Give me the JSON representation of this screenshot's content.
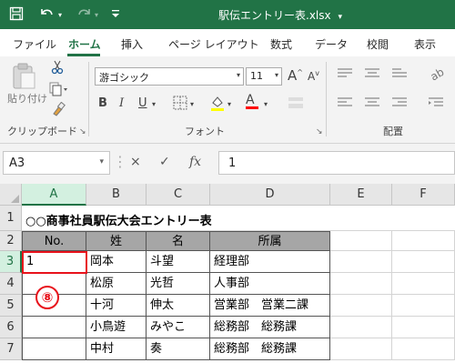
{
  "app": {
    "title": "駅伝エントリー表.xlsx",
    "title_dropdown_icon": "chevron-down-icon",
    "quick_access": {
      "save_icon": "save-icon",
      "undo_icon": "undo-icon",
      "redo_icon": "redo-icon",
      "customize_icon": "customize-qat-icon"
    }
  },
  "tabs": [
    "ファイル",
    "ホーム",
    "挿入",
    "ページ レイアウト",
    "数式",
    "データ",
    "校閲",
    "表示"
  ],
  "active_tab": "ホーム",
  "ribbon": {
    "clipboard": {
      "label": "クリップボード",
      "paste_label": "貼り付け",
      "cut_icon": "scissors-icon",
      "copy_icon": "copy-icon",
      "format_painter_icon": "format-painter-icon"
    },
    "font": {
      "label": "フォント",
      "font_name": "游ゴシック",
      "font_size": "11",
      "grow_label": "A",
      "shrink_label": "A",
      "bold_label": "B",
      "italic_label": "I",
      "underline_label": "U",
      "font_color_label": "A",
      "font_color": "#ff0000"
    },
    "alignment": {
      "label": "配置"
    }
  },
  "formula_bar": {
    "name_box": "A3",
    "cancel_icon": "×",
    "enter_icon": "✓",
    "fx_label": "fx",
    "value": "1"
  },
  "sheet": {
    "columns": [
      "A",
      "B",
      "C",
      "D",
      "E",
      "F"
    ],
    "rows": [
      "1",
      "2",
      "3",
      "4",
      "5",
      "6",
      "7"
    ],
    "title": "○○商事社員駅伝大会エントリー表",
    "header": [
      "No.",
      "姓",
      "名",
      "所属"
    ],
    "data": [
      [
        "1",
        "岡本",
        "斗望",
        "経理部"
      ],
      [
        "",
        "松原",
        "光哲",
        "人事部"
      ],
      [
        "",
        "十河",
        "伸太",
        "営業部　営業二課"
      ],
      [
        "",
        "小鳥遊",
        "みやこ",
        "総務部　総務課"
      ],
      [
        "",
        "中村",
        "奏",
        "総務部　総務課"
      ]
    ],
    "active_cell": "A3",
    "badge": "⑧",
    "accent_color": "#217346",
    "highlight_color": "#e8121b",
    "header_fill": "#a6a6a6"
  }
}
